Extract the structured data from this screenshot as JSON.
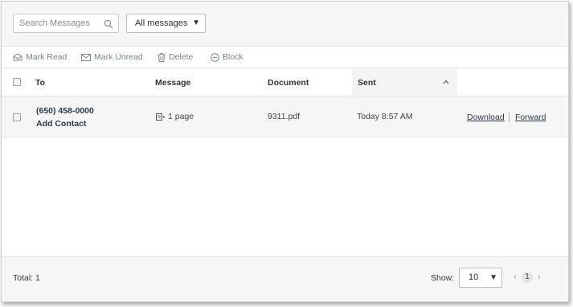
{
  "toolbar": {
    "search_placeholder": "Search Messages",
    "filter_value": "All messages"
  },
  "actions": {
    "mark_read": "Mark Read",
    "mark_unread": "Mark Unread",
    "delete": "Delete",
    "block": "Block"
  },
  "table": {
    "columns": {
      "to": "To",
      "message": "Message",
      "document": "Document",
      "sent": "Sent"
    },
    "rows": [
      {
        "to_number": "(650) 458-0000",
        "add_contact": "Add Contact",
        "message": "1 page",
        "document": "9311.pdf",
        "sent": "Today 8:57 AM",
        "download": "Download",
        "forward": "Forward"
      }
    ]
  },
  "footer": {
    "total": "Total: 1",
    "show_label": "Show:",
    "page_size": "10",
    "current_page": "1",
    "prev_glyph": "‹",
    "next_glyph": "›"
  }
}
